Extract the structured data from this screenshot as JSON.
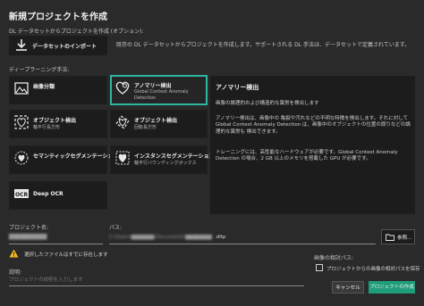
{
  "window": {
    "title": "新規プロジェクトを作成"
  },
  "import_section": {
    "label": "DL データセットからプロジェクトを作成 (オプション):",
    "button_label": "データセットのインポート",
    "description": "既存の DL データセットからプロジェクトを作成します。サポートされる DL 手法は、データセットで定義されています。"
  },
  "methods": {
    "label": "ディープラーニング手法:",
    "items": [
      {
        "label": "画像分類",
        "sub": "",
        "icon": "classification-icon"
      },
      {
        "label": "アノマリー検出",
        "sub": "Global Context Anomaly\nDetection",
        "icon": "anomaly-detection-icon",
        "selected": true
      },
      {
        "label": "オブジェクト検出",
        "sub": "軸平行長方形",
        "icon": "object-detection-icon"
      },
      {
        "label": "オブジェクト検出",
        "sub": "回転長方形",
        "icon": "object-detection-rotated-icon"
      },
      {
        "label": "セマンティックセグメンテーション",
        "sub": "",
        "icon": "semantic-segmentation-icon"
      },
      {
        "label": "インスタンスセグメンテーション",
        "sub": "軸平行バウンディングボックス",
        "icon": "instance-segmentation-icon"
      },
      {
        "label": "Deep OCR",
        "sub": "",
        "icon": "ocr-icon"
      }
    ]
  },
  "detail_panel": {
    "title": "アノマリー検出",
    "para1": "画像の論理的および構造的な異常を検出します",
    "para2": "アノマリー検出は、画像中の 亀裂や汚れなどの不明な特徴を検出します。それに対して Global Context Anomaly Detection は、画像中のオブジェクトの位置の誤りなどの論理的な異常も 検出できます。",
    "para3": "トレーニングには、高性能なハードウェアが必要です。Global Context Anomaly Detection の場合、2 GB 以上のメモリを搭載した GPU が必要です。"
  },
  "project_name": {
    "label": "プロジェクト名:",
    "value": "██████████"
  },
  "path": {
    "label": "パス:",
    "value": "C:\\Users\\██████\\Documents\\████████.dltp",
    "suffix": ".dltp",
    "browse_label": "参照..."
  },
  "warning": {
    "text": "選択したファイルはすでに存在します"
  },
  "description": {
    "label": "説明:",
    "placeholder": "プロジェクトの説明を入力します"
  },
  "relative_path": {
    "label": "画像の相対パス:",
    "checkbox_label": "プロジェクトからの画像の相対パスを保存",
    "checked": false
  },
  "footer": {
    "cancel_label": "キャンセル",
    "create_label": "プロジェクトの作成"
  },
  "colors": {
    "accent": "#2fb6a0",
    "background": "#2a2a2a",
    "tile": "#1c1c1c",
    "primary_button": "#1f9c7a"
  }
}
